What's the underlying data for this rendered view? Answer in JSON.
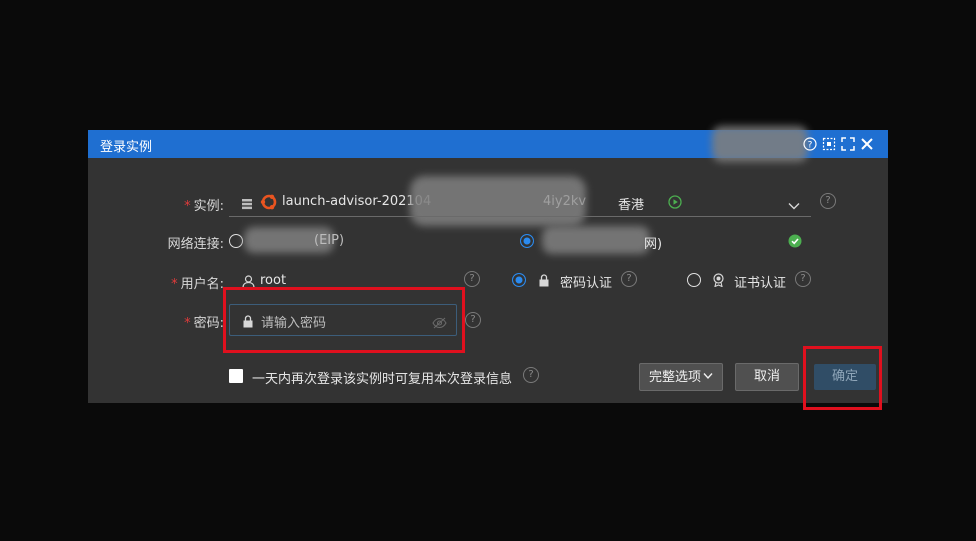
{
  "dialog": {
    "title": "登录实例",
    "instance": {
      "label": "实例:",
      "name": "launch-advisor-202104",
      "suffix": "4iy2kv",
      "region": "香港"
    },
    "network": {
      "label": "网络连接:",
      "option_public": "(EIP)",
      "option_private": "网)",
      "selected": "private"
    },
    "username": {
      "label": "用户名:",
      "value": "root",
      "auth_password": "密码认证",
      "auth_cert": "证书认证",
      "selected_auth": "password"
    },
    "password": {
      "label": "密码:",
      "placeholder": "请输入密码"
    },
    "remember_label": "一天内再次登录该实例时可复用本次登录信息",
    "buttons": {
      "full_options": "完整选项",
      "cancel": "取消",
      "confirm": "确定"
    }
  },
  "colors": {
    "titlebar": "#1f6fd1",
    "dialog_bg": "#333333",
    "highlight": "#e0101e",
    "radio_selected": "#2b8bf0",
    "status_ok": "#4caf50"
  }
}
